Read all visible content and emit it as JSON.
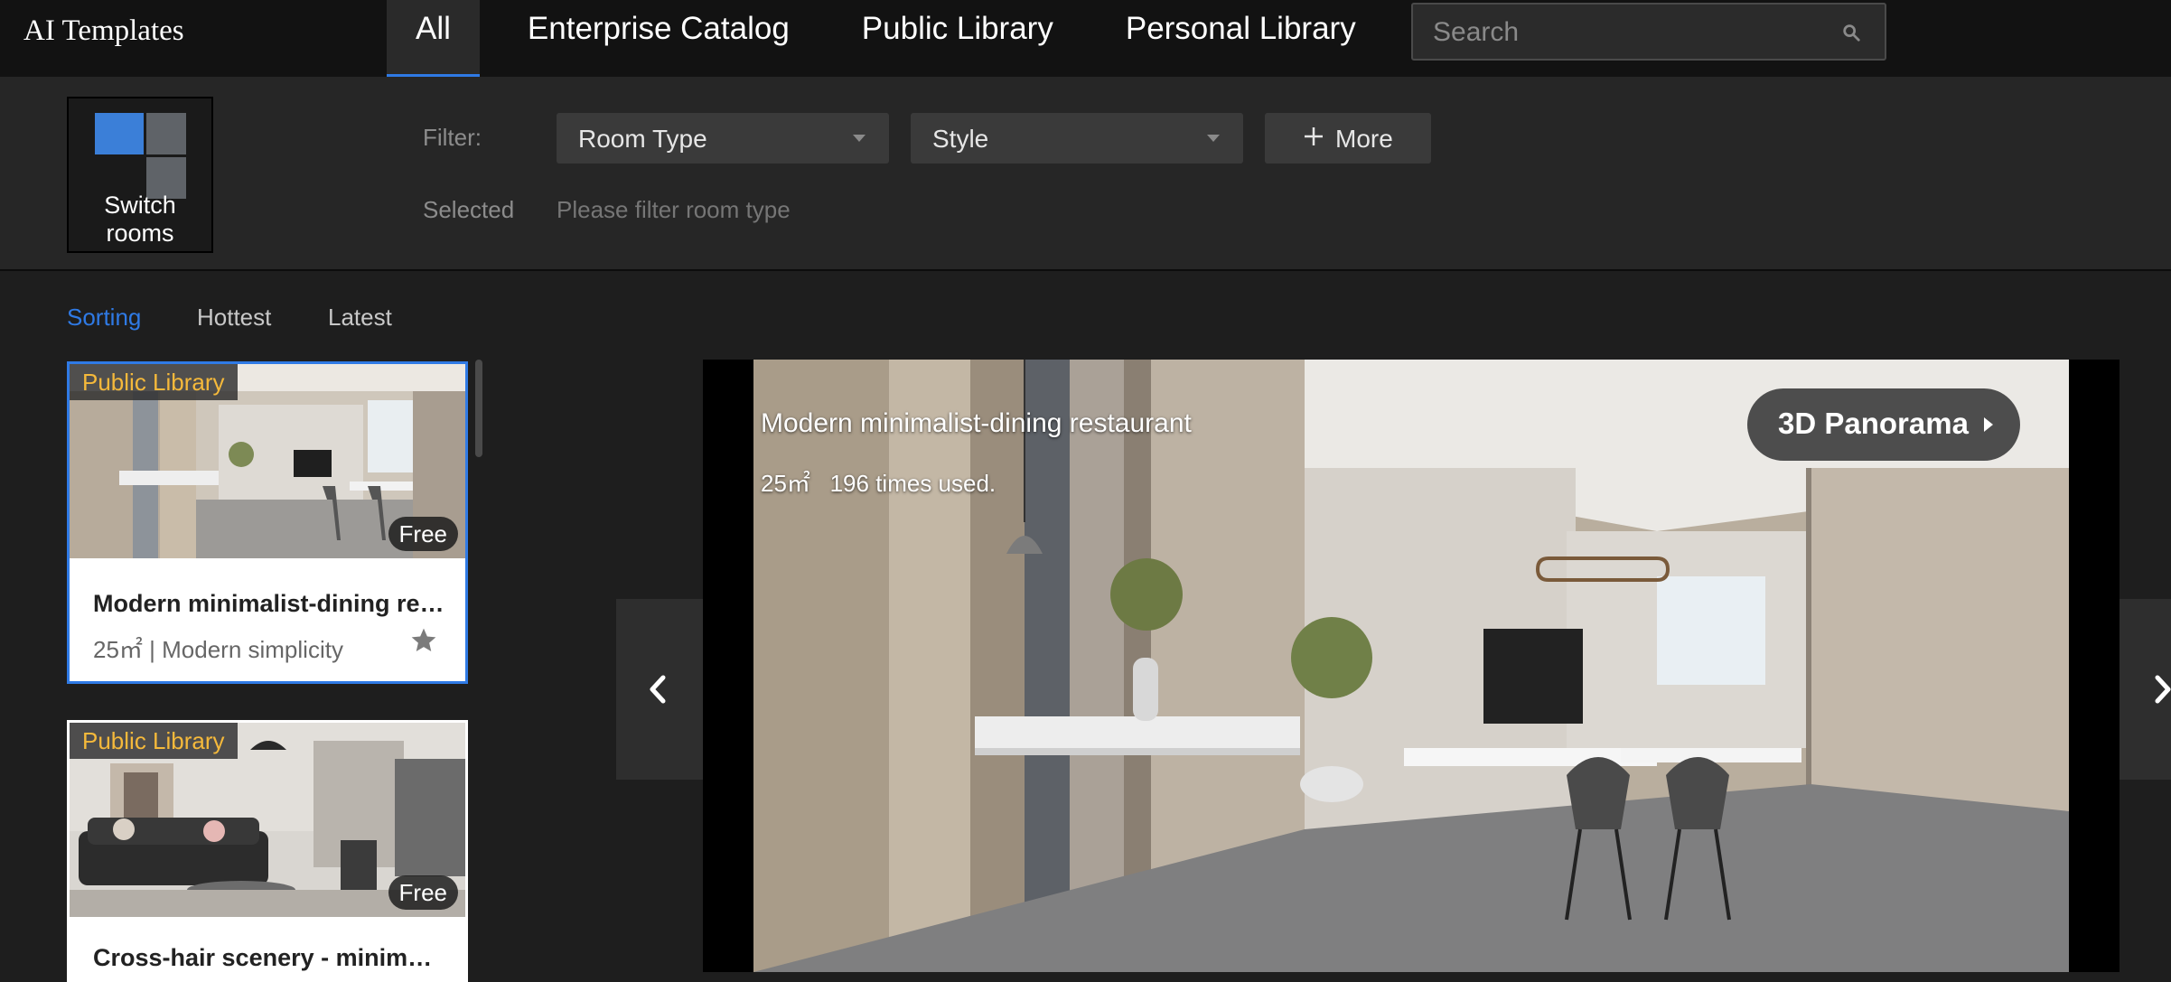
{
  "app": {
    "title": "AI Templates"
  },
  "nav": {
    "tabs": [
      {
        "label": "All",
        "active": true
      },
      {
        "label": "Enterprise Catalog"
      },
      {
        "label": "Public Library"
      },
      {
        "label": "Personal Library"
      }
    ]
  },
  "search": {
    "placeholder": "Search",
    "value": "",
    "icon": "search-icon"
  },
  "switch_rooms": {
    "label": "Switch rooms"
  },
  "filter": {
    "label": "Filter:",
    "room_type": "Room Type",
    "style": "Style",
    "more": "More",
    "selected_label": "Selected",
    "selected_hint": "Please filter room type"
  },
  "sorting": {
    "label": "Sorting",
    "hottest": "Hottest",
    "latest": "Latest"
  },
  "templates": [
    {
      "badge": "Public Library",
      "price": "Free",
      "title": "Modern minimalist-dining res...",
      "meta": "25㎡ | Modern simplicity",
      "selected": true
    },
    {
      "badge": "Public Library",
      "price": "Free",
      "title": "Cross-hair scenery - minimali..."
    }
  ],
  "preview": {
    "title": "Modern minimalist-dining restaurant",
    "area": "25㎡",
    "usage": "196 times used.",
    "panorama_button": "3D Panorama"
  },
  "colors": {
    "accent": "#2f7ae5",
    "badge_text": "#f5b93b",
    "topbar": "#121212",
    "panel": "#262626"
  }
}
